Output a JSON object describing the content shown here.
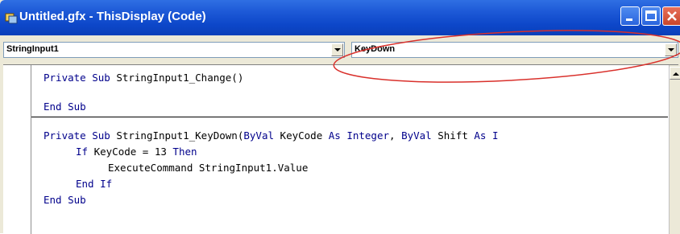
{
  "window": {
    "title": "Untitled.gfx - ThisDisplay (Code)"
  },
  "object_combo": {
    "value": "StringInput1"
  },
  "procedure_combo": {
    "value": "KeyDown"
  },
  "code": {
    "line1": {
      "kw": "Private Sub",
      "rest": " StringInput1_Change()"
    },
    "line2": {
      "kw": "End Sub"
    },
    "line3": {
      "kw1": "Private Sub",
      "mid1": " StringInput1_KeyDown(",
      "kw2": "ByVal",
      "mid2": " KeyCode ",
      "kw3": "As Integer",
      "mid3": ", ",
      "kw4": "ByVal",
      "mid4": " Shift ",
      "kw5": "As I"
    },
    "line4": {
      "kw1": "If",
      "mid": " KeyCode = 13 ",
      "kw2": "Then"
    },
    "line5": {
      "text": "ExecuteCommand StringInput1.Value"
    },
    "line6": {
      "kw": "End If"
    },
    "line7": {
      "kw": "End Sub"
    }
  },
  "colors": {
    "keyword": "#00008b",
    "titlebar": "#0d47c9",
    "annotation": "#d9302b"
  }
}
